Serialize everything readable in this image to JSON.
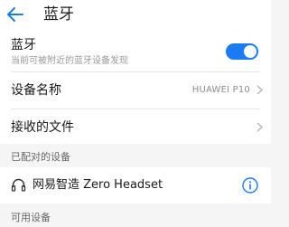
{
  "header": {
    "title": "蓝牙",
    "back_icon": "back-arrow-icon",
    "accent_color": "#1a7bf2"
  },
  "bluetooth": {
    "label": "蓝牙",
    "description": "当前可被附近的蓝牙设备发现",
    "toggle_on": true
  },
  "device_name": {
    "label": "设备名称",
    "value": "HUAWEI P10"
  },
  "received_files": {
    "label": "接收的文件"
  },
  "paired_section": {
    "header": "已配对的设备",
    "devices": [
      {
        "name": "网易智造 Zero Headset",
        "icon": "headset-icon",
        "action_icon": "info-icon"
      }
    ]
  },
  "available_section": {
    "header": "可用设备"
  }
}
